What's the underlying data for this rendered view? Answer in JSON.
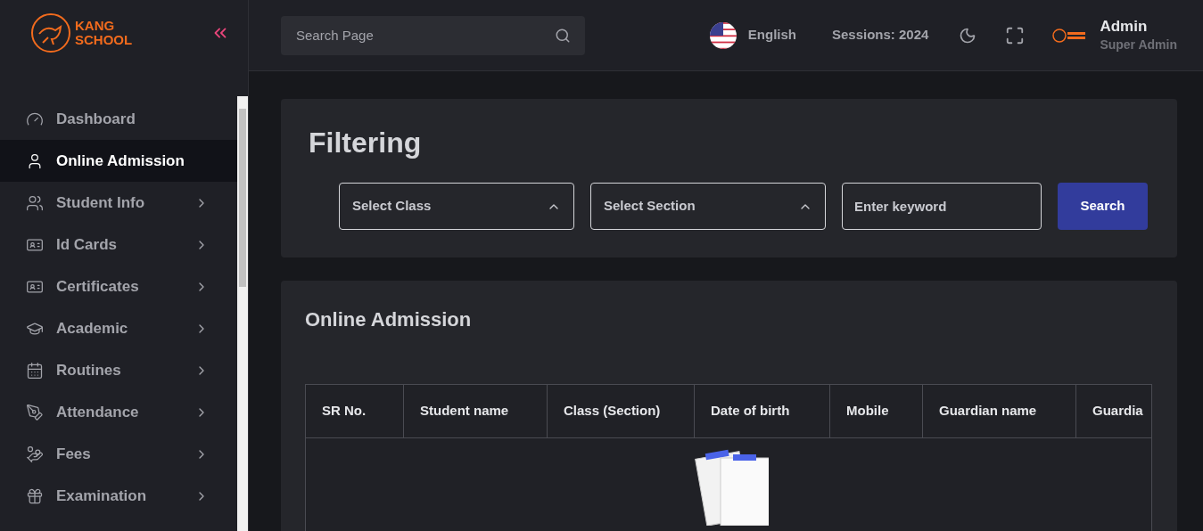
{
  "brand": {
    "line1": "KANG",
    "line2": "SCHOOL"
  },
  "sidebar": {
    "items": [
      {
        "label": "Dashboard",
        "selected": false,
        "has_children": false
      },
      {
        "label": "Online Admission",
        "selected": true,
        "has_children": false
      },
      {
        "label": "Student Info",
        "selected": false,
        "has_children": true
      },
      {
        "label": "Id Cards",
        "selected": false,
        "has_children": true
      },
      {
        "label": "Certificates",
        "selected": false,
        "has_children": true
      },
      {
        "label": "Academic",
        "selected": false,
        "has_children": true
      },
      {
        "label": "Routines",
        "selected": false,
        "has_children": true
      },
      {
        "label": "Attendance",
        "selected": false,
        "has_children": true
      },
      {
        "label": "Fees",
        "selected": false,
        "has_children": true
      },
      {
        "label": "Examination",
        "selected": false,
        "has_children": true
      }
    ]
  },
  "header": {
    "search": {
      "placeholder": "Search Page"
    },
    "language": "English",
    "session": "Sessions: 2024",
    "user": {
      "name": "Admin",
      "role": "Super Admin"
    }
  },
  "filter": {
    "title": "Filtering",
    "class_select": "Select Class",
    "section_select": "Select Section",
    "keyword": {
      "placeholder": "Enter keyword"
    },
    "button": "Search"
  },
  "table_card": {
    "title": "Online Admission",
    "columns": [
      "SR No.",
      "Student name",
      "Class (Section)",
      "Date of birth",
      "Mobile",
      "Guardian name",
      "Guardia"
    ]
  }
}
